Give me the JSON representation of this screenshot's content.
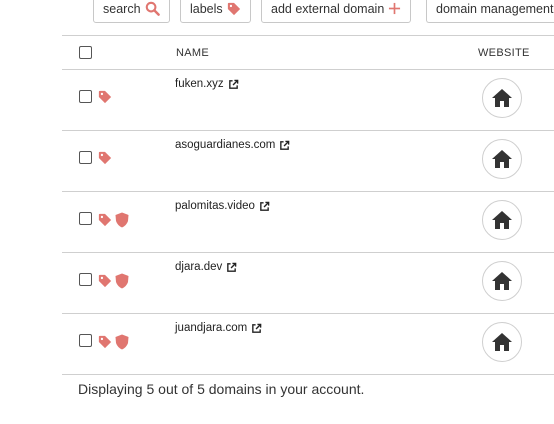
{
  "toolbar": {
    "search_label": "search",
    "labels_label": "labels",
    "add_domain_label": "add external domain",
    "domain_management_label": "domain management",
    "accent_color": "#e07670"
  },
  "table": {
    "columns": {
      "name": "NAME",
      "website": "WEBSITE"
    },
    "rows": [
      {
        "domain": "fuken.xyz",
        "icons": [
          "tag-icon"
        ]
      },
      {
        "domain": "asoguardianes.com",
        "icons": [
          "tag-icon"
        ]
      },
      {
        "domain": "palomitas.video",
        "icons": [
          "tag-icon",
          "shield-icon"
        ]
      },
      {
        "domain": "djara.dev",
        "icons": [
          "tag-icon",
          "shield-icon"
        ]
      },
      {
        "domain": "juandjara.com",
        "icons": [
          "tag-icon",
          "shield-icon"
        ]
      }
    ]
  },
  "footer": {
    "text": "Displaying 5 out of 5 domains in your account."
  }
}
